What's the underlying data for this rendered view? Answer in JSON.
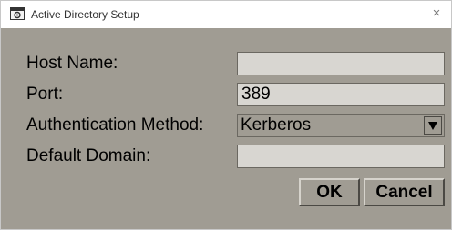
{
  "window": {
    "title": "Active Directory Setup",
    "app_icon": "gear-window-icon",
    "close_icon": "close-icon",
    "close_glyph": "×"
  },
  "form": {
    "host_name": {
      "label": "Host Name:",
      "value": ""
    },
    "port": {
      "label": "Port:",
      "value": "389"
    },
    "auth_method": {
      "label": "Authentication Method:",
      "value": "Kerberos",
      "icon": "dropdown-arrow-icon"
    },
    "default_domain": {
      "label": "Default Domain:",
      "value": ""
    }
  },
  "buttons": {
    "ok": "OK",
    "cancel": "Cancel"
  }
}
